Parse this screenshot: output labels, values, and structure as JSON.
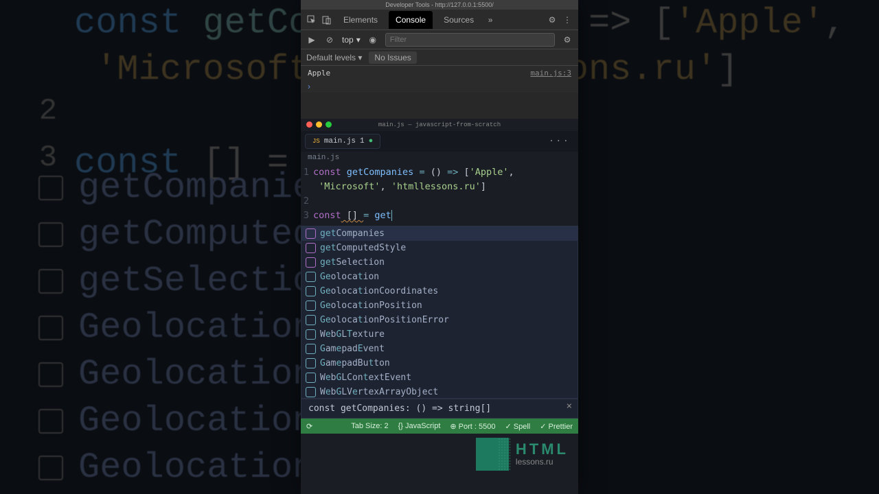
{
  "bg": {
    "line1a": "const",
    "line1b": "getCompanies",
    "line1c": " = () => [",
    "l1str1": "'Apple'",
    "l1mid": ",\n  ",
    "l1str2": "'Microsoft'",
    "l1str3": "'htmllessons.ru'",
    "l1end": "]",
    "line3a": "const",
    "line3b": " [] = ge",
    "sugg": [
      "getCompanies",
      "getComputedSt",
      "getSelection",
      "Geolocation",
      "GeolocationCc",
      "GeolocationPc",
      "GeolocationPc"
    ]
  },
  "devtools": {
    "title": "Developer Tools - http://127.0.0.1:5500/",
    "tabs": {
      "elements": "Elements",
      "console": "Console",
      "sources": "Sources"
    },
    "context": "top",
    "filter_placeholder": "Filter",
    "levels": "Default levels",
    "issues": "No Issues",
    "log_text": "Apple",
    "log_src": "main.js:3"
  },
  "vscode": {
    "title": "main.js — javascript-from-scratch",
    "tab": {
      "kind": "JS",
      "name": "main.js",
      "num": "1"
    },
    "breadcrumb": "main.js",
    "code": {
      "l1": {
        "kw": "const",
        "fn": " getCompanies ",
        "op": "=",
        "args": " () ",
        "arrow": "=>",
        "br": " [",
        "s1": "'Apple'",
        "c": ","
      },
      "l1b": {
        "s2": "'Microsoft'",
        "c1": ", ",
        "s3": "'htmllessons.ru'",
        "end": "]"
      },
      "l3": {
        "kw": "const",
        "mid": " [] ",
        "op": "=",
        "call": " get"
      }
    },
    "suggest": [
      {
        "kind": "fn",
        "label": "getCompanies",
        "hl": 3
      },
      {
        "kind": "fn",
        "label": "getComputedStyle",
        "hl": 3
      },
      {
        "kind": "fn",
        "label": "getSelection",
        "hl": 3
      },
      {
        "kind": "var",
        "label": "Geolocation",
        "hl": 2
      },
      {
        "kind": "var",
        "label": "GeolocationCoordinates",
        "hl": 2
      },
      {
        "kind": "var",
        "label": "GeolocationPosition",
        "hl": 2
      },
      {
        "kind": "var",
        "label": "GeolocationPositionError",
        "hl": 2
      },
      {
        "kind": "var",
        "label": "WebGLTexture",
        "hl": 0
      },
      {
        "kind": "var",
        "label": "GamepadEvent",
        "hl": 0
      },
      {
        "kind": "var",
        "label": "GamepadButton",
        "hl": 0
      },
      {
        "kind": "var",
        "label": "WebGLContextEvent",
        "hl": 0
      },
      {
        "kind": "var",
        "label": "WebGLVertexArrayObject",
        "hl": 0
      }
    ],
    "signature": "const getCompanies: () => string[]"
  },
  "logo": {
    "l1": "HTML",
    "l2": "lessons.ru"
  },
  "status": {
    "tab_size": "Tab Size: 2",
    "lang": "JavaScript",
    "port": "Port : 5500",
    "spell": "Spell",
    "prettier": "Prettier"
  }
}
